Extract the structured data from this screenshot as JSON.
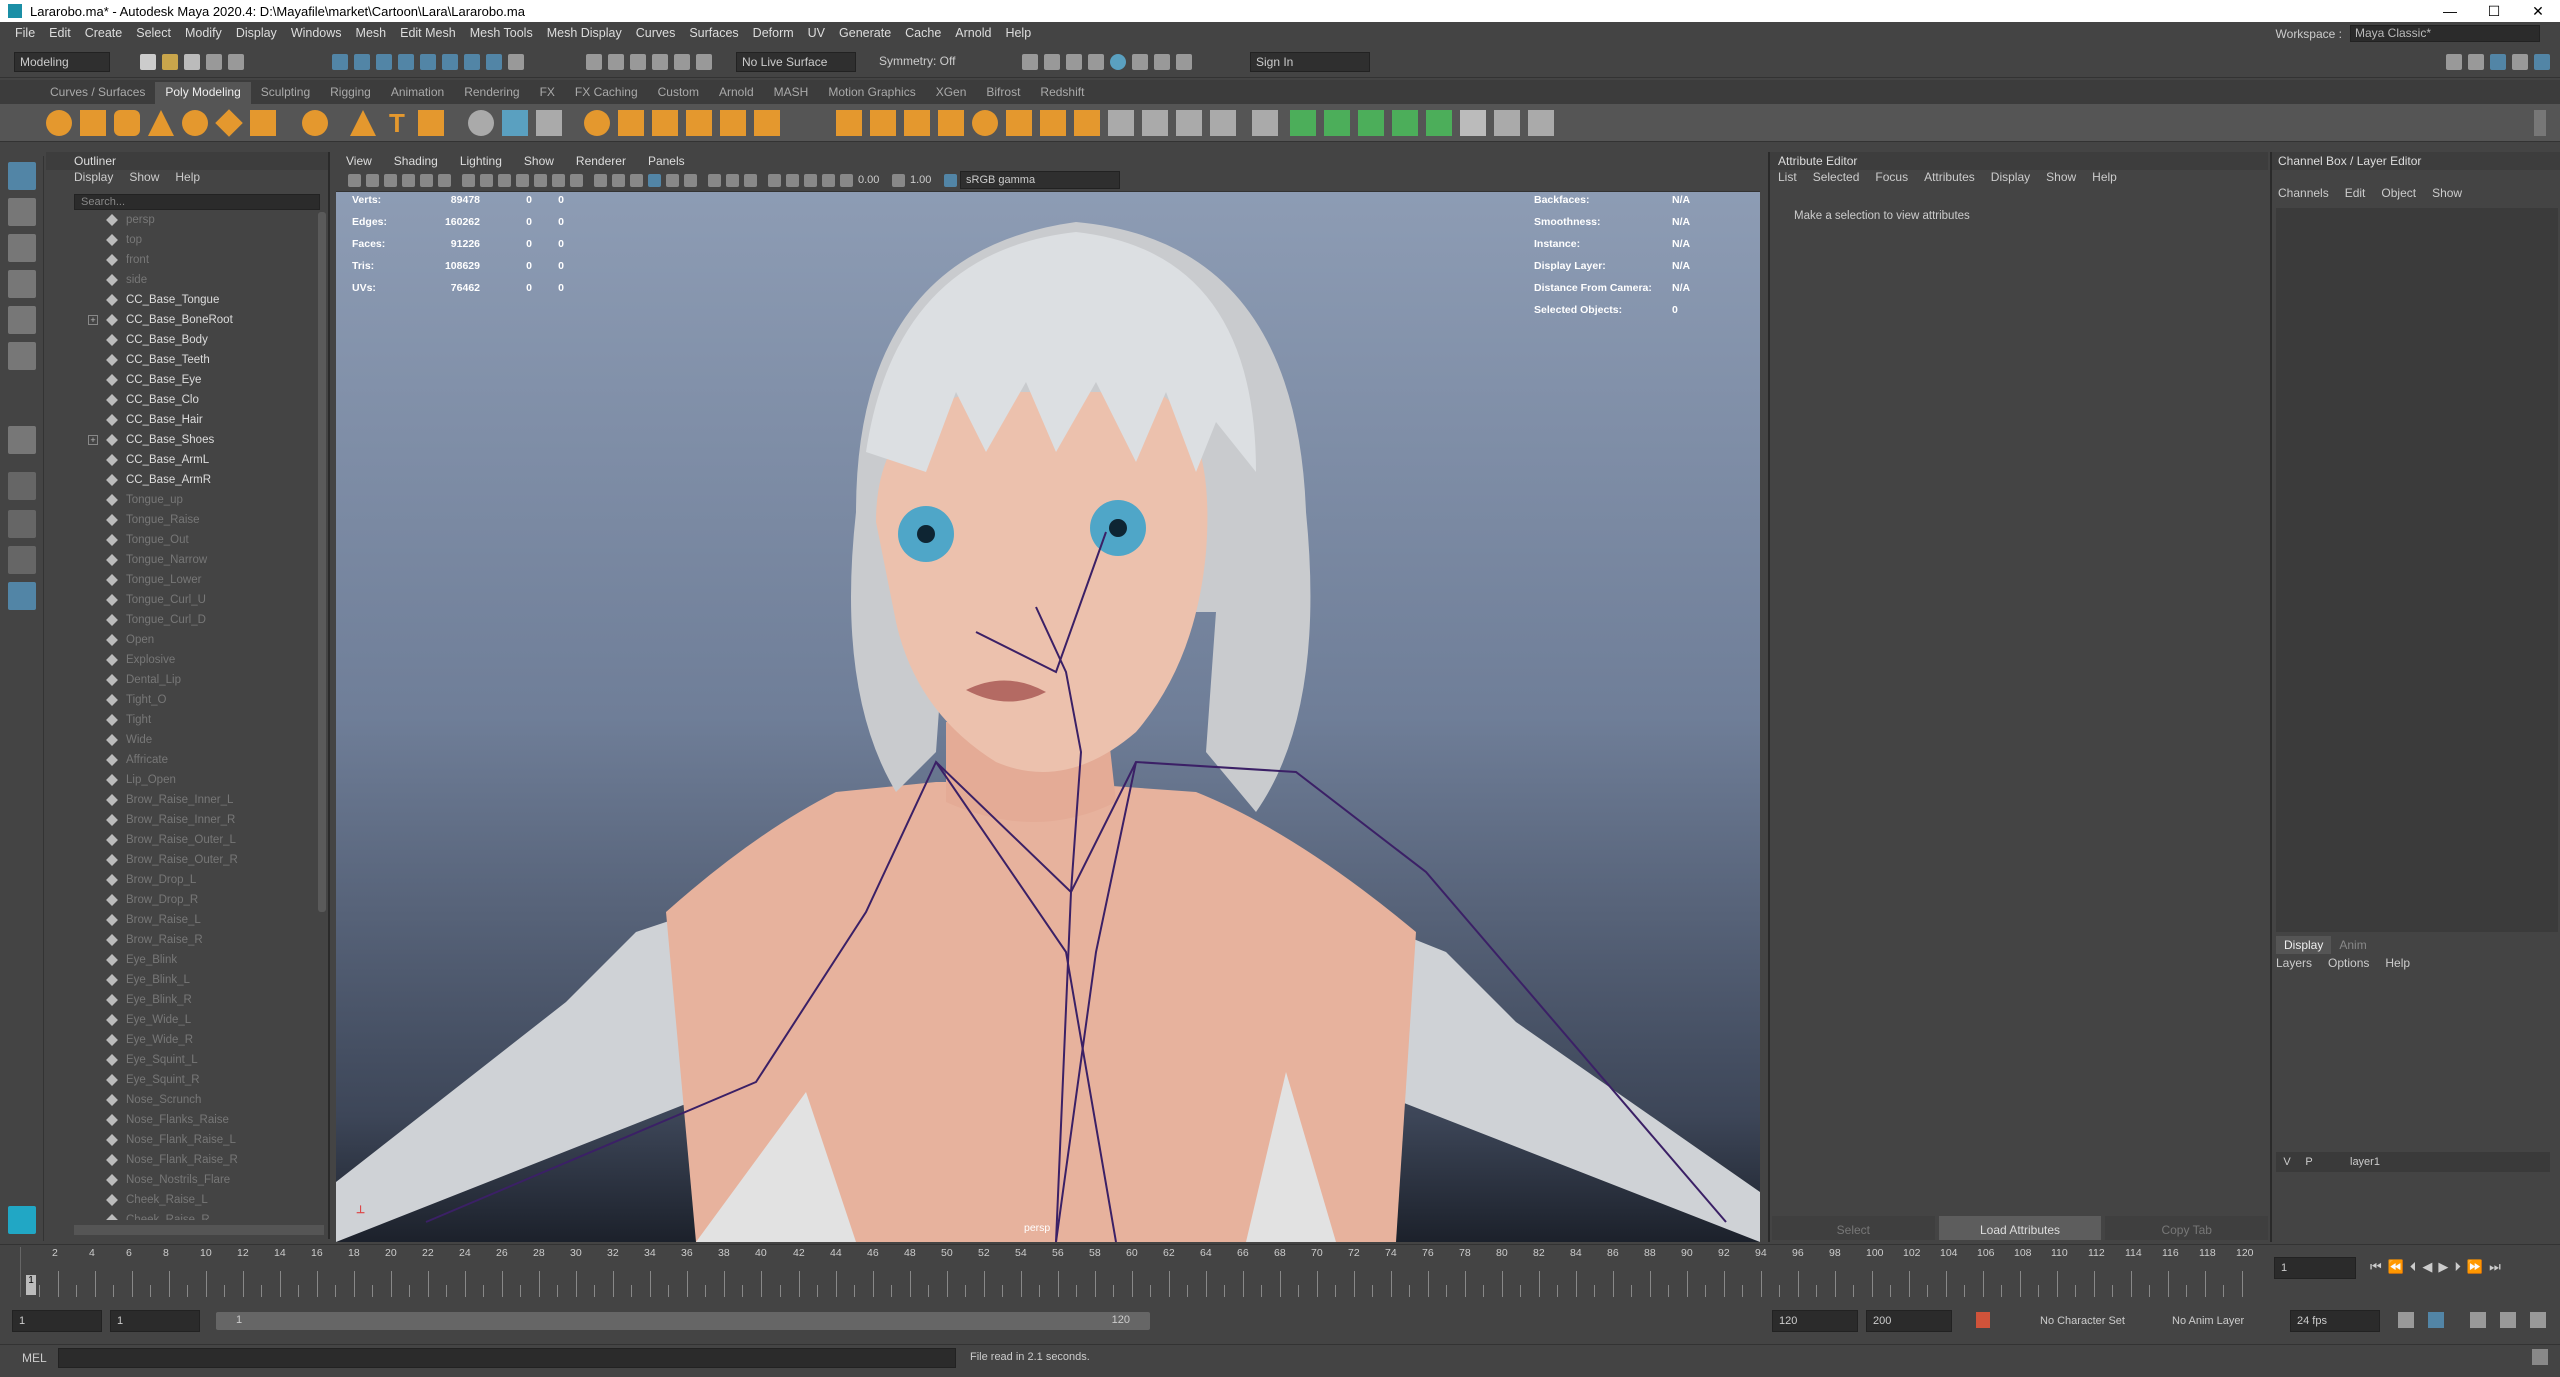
{
  "window": {
    "title": "Lararobo.ma* - Autodesk Maya 2020.4: D:\\Mayafile\\market\\Cartoon\\Lara\\Lararobo.ma",
    "buttons": [
      "—",
      "☐",
      "✕"
    ]
  },
  "menus": [
    "File",
    "Edit",
    "Create",
    "Select",
    "Modify",
    "Display",
    "Windows",
    "Mesh",
    "Edit Mesh",
    "Mesh Tools",
    "Mesh Display",
    "Curves",
    "Surfaces",
    "Deform",
    "UV",
    "Generate",
    "Cache",
    "Arnold",
    "Help"
  ],
  "workspace": {
    "label": "Workspace :",
    "value": "Maya Classic*"
  },
  "status": {
    "mode": "Modeling",
    "live_surface": "No Live Surface",
    "symmetry": "Symmetry: Off",
    "sign_in": "Sign In"
  },
  "shelf_tabs": [
    "Curves / Surfaces",
    "Poly Modeling",
    "Sculpting",
    "Rigging",
    "Animation",
    "Rendering",
    "FX",
    "FX Caching",
    "Custom",
    "Arnold",
    "MASH",
    "Motion Graphics",
    "XGen",
    "Bifrost",
    "Redshift"
  ],
  "shelf_active": "Poly Modeling",
  "outliner": {
    "title": "Outliner",
    "menu": [
      "Display",
      "Show",
      "Help"
    ],
    "search_placeholder": "Search...",
    "items": [
      {
        "name": "persp",
        "dim": true
      },
      {
        "name": "top",
        "dim": true
      },
      {
        "name": "front",
        "dim": true
      },
      {
        "name": "side",
        "dim": true
      },
      {
        "name": "CC_Base_Tongue",
        "dim": false
      },
      {
        "name": "CC_Base_BoneRoot",
        "dim": false,
        "expand": true
      },
      {
        "name": "CC_Base_Body",
        "dim": false
      },
      {
        "name": "CC_Base_Teeth",
        "dim": false
      },
      {
        "name": "CC_Base_Eye",
        "dim": false
      },
      {
        "name": "CC_Base_Clo",
        "dim": false
      },
      {
        "name": "CC_Base_Hair",
        "dim": false
      },
      {
        "name": "CC_Base_Shoes",
        "dim": false,
        "expand": true
      },
      {
        "name": "CC_Base_ArmL",
        "dim": false
      },
      {
        "name": "CC_Base_ArmR",
        "dim": false
      },
      {
        "name": "Tongue_up",
        "dim": true
      },
      {
        "name": "Tongue_Raise",
        "dim": true
      },
      {
        "name": "Tongue_Out",
        "dim": true
      },
      {
        "name": "Tongue_Narrow",
        "dim": true
      },
      {
        "name": "Tongue_Lower",
        "dim": true
      },
      {
        "name": "Tongue_Curl_U",
        "dim": true
      },
      {
        "name": "Tongue_Curl_D",
        "dim": true
      },
      {
        "name": "Open",
        "dim": true
      },
      {
        "name": "Explosive",
        "dim": true
      },
      {
        "name": "Dental_Lip",
        "dim": true
      },
      {
        "name": "Tight_O",
        "dim": true
      },
      {
        "name": "Tight",
        "dim": true
      },
      {
        "name": "Wide",
        "dim": true
      },
      {
        "name": "Affricate",
        "dim": true
      },
      {
        "name": "Lip_Open",
        "dim": true
      },
      {
        "name": "Brow_Raise_Inner_L",
        "dim": true
      },
      {
        "name": "Brow_Raise_Inner_R",
        "dim": true
      },
      {
        "name": "Brow_Raise_Outer_L",
        "dim": true
      },
      {
        "name": "Brow_Raise_Outer_R",
        "dim": true
      },
      {
        "name": "Brow_Drop_L",
        "dim": true
      },
      {
        "name": "Brow_Drop_R",
        "dim": true
      },
      {
        "name": "Brow_Raise_L",
        "dim": true
      },
      {
        "name": "Brow_Raise_R",
        "dim": true
      },
      {
        "name": "Eye_Blink",
        "dim": true
      },
      {
        "name": "Eye_Blink_L",
        "dim": true
      },
      {
        "name": "Eye_Blink_R",
        "dim": true
      },
      {
        "name": "Eye_Wide_L",
        "dim": true
      },
      {
        "name": "Eye_Wide_R",
        "dim": true
      },
      {
        "name": "Eye_Squint_L",
        "dim": true
      },
      {
        "name": "Eye_Squint_R",
        "dim": true
      },
      {
        "name": "Nose_Scrunch",
        "dim": true
      },
      {
        "name": "Nose_Flanks_Raise",
        "dim": true
      },
      {
        "name": "Nose_Flank_Raise_L",
        "dim": true
      },
      {
        "name": "Nose_Flank_Raise_R",
        "dim": true
      },
      {
        "name": "Nose_Nostrils_Flare",
        "dim": true
      },
      {
        "name": "Cheek_Raise_L",
        "dim": true
      },
      {
        "name": "Cheek_Raise_R",
        "dim": true
      }
    ]
  },
  "viewport": {
    "menu": [
      "View",
      "Shading",
      "Lighting",
      "Show",
      "Renderer",
      "Panels"
    ],
    "exposure": "0.00",
    "gamma": "1.00",
    "colorspace": "sRGB gamma",
    "camera_label": "persp",
    "hud_left": [
      {
        "label": "Verts:",
        "v1": "89478",
        "v2": "0",
        "v3": "0"
      },
      {
        "label": "Edges:",
        "v1": "160262",
        "v2": "0",
        "v3": "0"
      },
      {
        "label": "Faces:",
        "v1": "91226",
        "v2": "0",
        "v3": "0"
      },
      {
        "label": "Tris:",
        "v1": "108629",
        "v2": "0",
        "v3": "0"
      },
      {
        "label": "UVs:",
        "v1": "76462",
        "v2": "0",
        "v3": "0"
      }
    ],
    "hud_right": [
      {
        "label": "Backfaces:",
        "value": "N/A"
      },
      {
        "label": "Smoothness:",
        "value": "N/A"
      },
      {
        "label": "Instance:",
        "value": "N/A"
      },
      {
        "label": "Display Layer:",
        "value": "N/A"
      },
      {
        "label": "Distance From Camera:",
        "value": "N/A"
      },
      {
        "label": "Selected Objects:",
        "value": "0"
      }
    ]
  },
  "attribute_editor": {
    "title": "Attribute Editor",
    "menu": [
      "List",
      "Selected",
      "Focus",
      "Attributes",
      "Display",
      "Show",
      "Help"
    ],
    "message": "Make a selection to view attributes",
    "buttons": {
      "select": "Select",
      "load": "Load Attributes",
      "copy": "Copy Tab"
    }
  },
  "channel_box": {
    "title": "Channel Box / Layer Editor",
    "menu": [
      "Channels",
      "Edit",
      "Object",
      "Show"
    ],
    "tabs": {
      "display": "Display",
      "anim": "Anim"
    },
    "layer_menu": [
      "Layers",
      "Options",
      "Help"
    ],
    "layer": {
      "v": "V",
      "p": "P",
      "name": "layer1"
    }
  },
  "timeline": {
    "ticks": [
      "2",
      "4",
      "6",
      "8",
      "10",
      "12",
      "14",
      "16",
      "18",
      "20",
      "22",
      "24",
      "26",
      "28",
      "30",
      "32",
      "34",
      "36",
      "38",
      "40",
      "42",
      "44",
      "46",
      "48",
      "50",
      "52",
      "54",
      "56",
      "58",
      "60",
      "62",
      "64",
      "66",
      "68",
      "70",
      "72",
      "74",
      "76",
      "78",
      "80",
      "82",
      "84",
      "86",
      "88",
      "90",
      "92",
      "94",
      "96",
      "98",
      "100",
      "102",
      "104",
      "106",
      "108",
      "110",
      "112",
      "114",
      "116",
      "118",
      "120"
    ],
    "current_frame_marker": "1",
    "current_frame_field": "1"
  },
  "range": {
    "start": "1",
    "start2": "1",
    "slider_start": "1",
    "slider_end": "120",
    "end": "120",
    "end2": "200",
    "character_set": "No Character Set",
    "anim_layer": "No Anim Layer",
    "fps": "24 fps"
  },
  "command": {
    "lang": "MEL",
    "feedback": "File read in  2.1 seconds."
  },
  "colors": {
    "accent": "#5285a6",
    "viewport_top": "#8d9cb4",
    "viewport_bottom": "#1c212b",
    "skeleton": "#3b2066"
  }
}
